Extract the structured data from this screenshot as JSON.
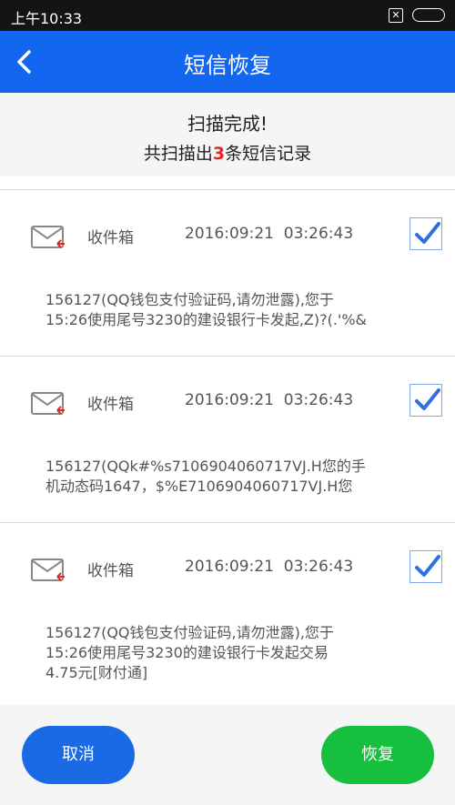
{
  "status_bar": {
    "time": "上午10:33",
    "notification_icon": "x-icon",
    "battery_icon": "battery-icon"
  },
  "app_bar": {
    "title": "短信恢复",
    "back_icon": "chevron-left-icon",
    "color": "#1366f0"
  },
  "summary": {
    "title": "扫描完成!",
    "count_prefix": "共扫描出",
    "count": "3",
    "count_suffix": "条短信记录",
    "count_color": "#e52424"
  },
  "records": [
    {
      "folder": "收件箱",
      "time": "2016:09:21  03:26:43",
      "checked": true,
      "lines": [
        "156127(QQ钱包支付验证码,请勿泄露),您于",
        "15:26使用尾号3230的建设银行卡发起,Z)?(.'%&"
      ]
    },
    {
      "folder": "收件箱",
      "time": "2016:09:21  03:26:43",
      "checked": true,
      "lines": [
        "156127(QQk#%s7106904060717VJ.H您的手",
        "机动态码1647，$%E7106904060717VJ.H您"
      ]
    },
    {
      "folder": "收件箱",
      "time": "2016:09:21  03:26:43",
      "checked": true,
      "lines": [
        "156127(QQ钱包支付验证码,请勿泄露),您于",
        "15:26使用尾号3230的建设银行卡发起交易",
        "4.75元[财付通]"
      ]
    }
  ],
  "buttons": {
    "cancel": "取消",
    "recover": "恢复",
    "cancel_color": "#1a6ae6",
    "recover_color": "#16c03e"
  }
}
